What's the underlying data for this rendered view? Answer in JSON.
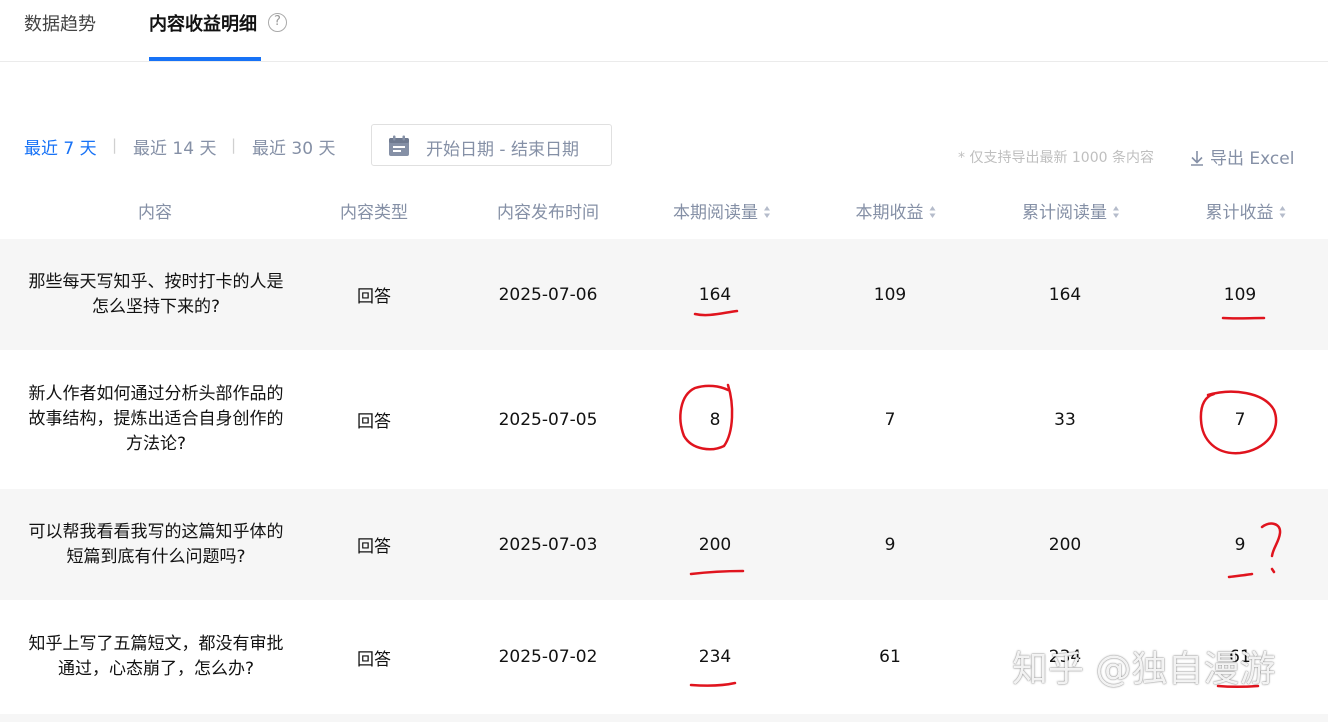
{
  "tabs": [
    {
      "label": "数据趋势",
      "active": false
    },
    {
      "label": "内容收益明细",
      "active": true
    }
  ],
  "help_icon": "question-circle-icon",
  "filters": {
    "ranges": [
      "最近 7 天",
      "最近 14 天",
      "最近 30 天"
    ],
    "separator": "|",
    "selected": 0,
    "date_range": "开始日期 - 结束日期"
  },
  "export": {
    "note": "* 仅支持导出最新 1000 条内容",
    "label": "导出 Excel"
  },
  "table": {
    "columns": [
      "内容",
      "内容类型",
      "内容发布时间",
      "本期阅读量",
      "本期收益",
      "累计阅读量",
      "累计收益"
    ],
    "rows": [
      {
        "title_line1": "那些每天写知乎、按时打卡的人是",
        "title_line2": "怎么坚持下来的?",
        "title_line3": "",
        "type": "回答",
        "date": "2025-07-06",
        "period_reads": "164",
        "period_income": "109",
        "total_reads": "164",
        "total_income": "109"
      },
      {
        "title_line1": "新人作者如何通过分析头部作品的",
        "title_line2": "故事结构，提炼出适合自身创作的",
        "title_line3": "方法论?",
        "type": "回答",
        "date": "2025-07-05",
        "period_reads": "8",
        "period_income": "7",
        "total_reads": "33",
        "total_income": "7"
      },
      {
        "title_line1": "可以帮我看看我写的这篇知乎体的",
        "title_line2": "短篇到底有什么问题吗?",
        "title_line3": "",
        "type": "回答",
        "date": "2025-07-03",
        "period_reads": "200",
        "period_income": "9",
        "total_reads": "200",
        "total_income": "9"
      },
      {
        "title_line1": "知乎上写了五篇短文，都没有审批",
        "title_line2": "通过，心态崩了，怎么办?",
        "title_line3": "",
        "type": "回答",
        "date": "2025-07-02",
        "period_reads": "234",
        "period_income": "61",
        "total_reads": "234",
        "total_income": "61"
      }
    ]
  },
  "annotation_color": "#e0141e",
  "watermark": "知乎 @独自漫游",
  "accent_color": "#1772f6"
}
